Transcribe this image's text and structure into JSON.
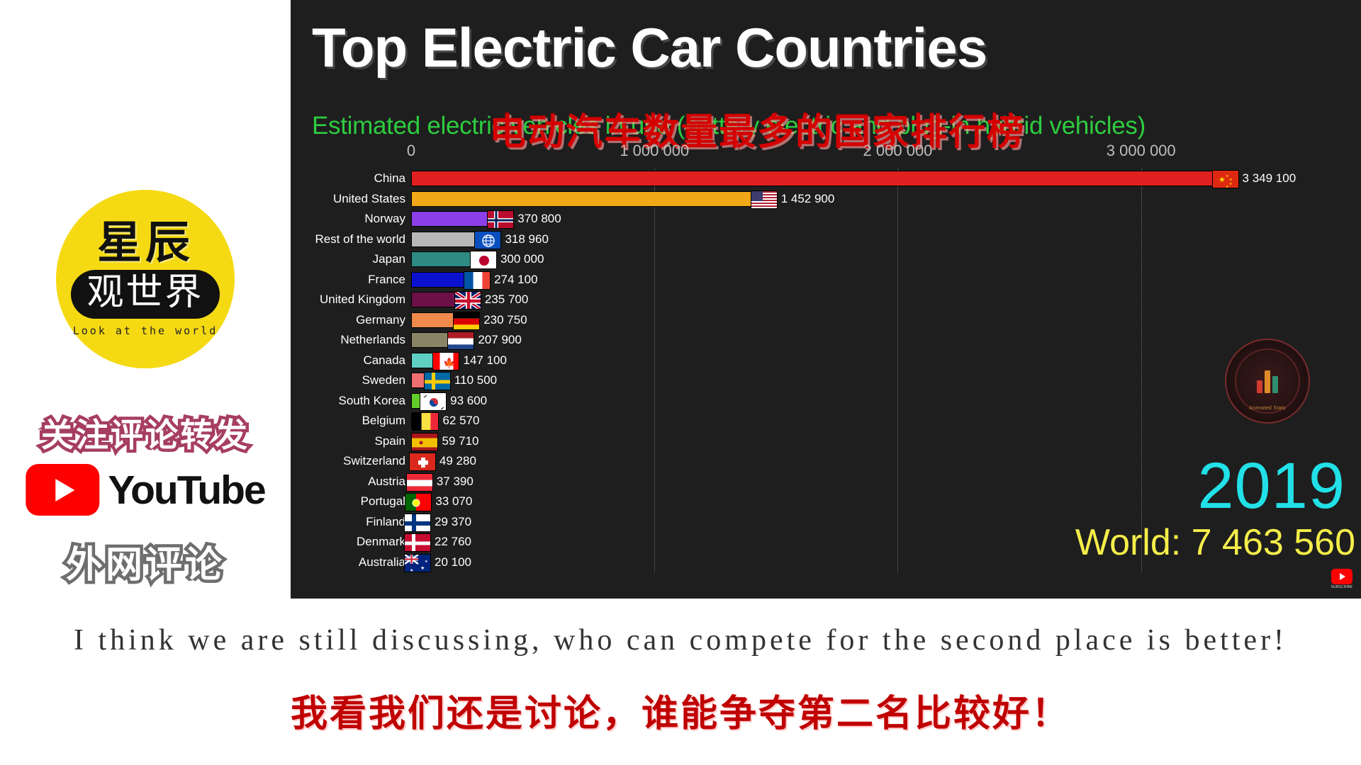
{
  "sidebar": {
    "logo": {
      "top_text": "星辰",
      "pill_text": "观世界",
      "tagline": "Look at the world",
      "circle_color": "#F5D913"
    },
    "promo_line_1": "关注评论转发",
    "youtube_label": "YouTube",
    "promo_line_2": "外网评论"
  },
  "chart": {
    "title": "Top Electric Car Countries",
    "subtitle": "Estimated electric vehicles in use (battery electric and plug-in hybrid vehicles)",
    "subtitle_cn": "电动汽车数量最多的国家排行榜",
    "year": "2019",
    "world_label": "World: 7 463 560",
    "watermark": "Animated Stats",
    "subscribe_label": "SUBSCRIBE",
    "colors": {
      "panel_bg": "#1E1E1E",
      "title": "#FFFFFF",
      "subtitle": "#2ECC40",
      "subtitle_cn": "#D40000",
      "year": "#22E0E8",
      "world": "#F5EE4A"
    }
  },
  "chart_data": {
    "type": "bar",
    "orientation": "horizontal",
    "title": "Top Electric Car Countries",
    "subtitle": "Estimated electric vehicles in use (battery electric and plug-in hybrid vehicles)",
    "xlabel": "",
    "ylabel": "",
    "xlim": [
      0,
      3700000
    ],
    "grid": true,
    "tick_labels": [
      "0",
      "1 000 000",
      "2 000 000",
      "3 000 000"
    ],
    "tick_values": [
      0,
      1000000,
      2000000,
      3000000
    ],
    "legend": "none",
    "annotations": {
      "year": "2019",
      "world_total": "World: 7 463 560",
      "world_total_value": 7463560
    },
    "categories": [
      "China",
      "United States",
      "Norway",
      "Rest of the world",
      "Japan",
      "France",
      "United Kingdom",
      "Germany",
      "Netherlands",
      "Canada",
      "Sweden",
      "South Korea",
      "Belgium",
      "Spain",
      "Switzerland",
      "Austria",
      "Portugal",
      "Finland",
      "Denmark",
      "Australia"
    ],
    "values": [
      3349100,
      1452900,
      370800,
      318960,
      300000,
      274100,
      235700,
      230750,
      207900,
      147100,
      110500,
      93600,
      62570,
      59710,
      49280,
      37390,
      33070,
      29370,
      22760,
      20100
    ],
    "value_labels": [
      "3 349 100",
      "1 452 900",
      "370 800",
      "318 960",
      "300 000",
      "274 100",
      "235 700",
      "230 750",
      "207 900",
      "147 100",
      "110 500",
      "93 600",
      "62 570",
      "59 710",
      "49 280",
      "37 390",
      "33 070",
      "29 370",
      "22 760",
      "20 100"
    ],
    "bar_colors": [
      "#E02020",
      "#F0A818",
      "#8A3FE8",
      "#B8B8B8",
      "#2E8B84",
      "#0A12D0",
      "#6E1048",
      "#F08A4B",
      "#8A8466",
      "#5FCFC4",
      "#EE7070",
      "#62CC2A",
      "#8A4520",
      "#C5AE5E",
      "#86BCD6",
      "#4A1E6E",
      "#D8A0B4",
      "#E824E8",
      "#7FBFA8",
      "#C86A18"
    ],
    "flags": [
      "cn",
      "us",
      "no",
      "world",
      "jp",
      "fr",
      "gb",
      "de",
      "nl",
      "ca",
      "se",
      "kr",
      "be",
      "es",
      "ch",
      "at",
      "pt",
      "fi",
      "dk",
      "au"
    ]
  },
  "captions": {
    "english": "I think we are still discussing, who can compete for the second place is better!",
    "chinese": "我看我们还是讨论，谁能争夺第二名比较好！"
  }
}
